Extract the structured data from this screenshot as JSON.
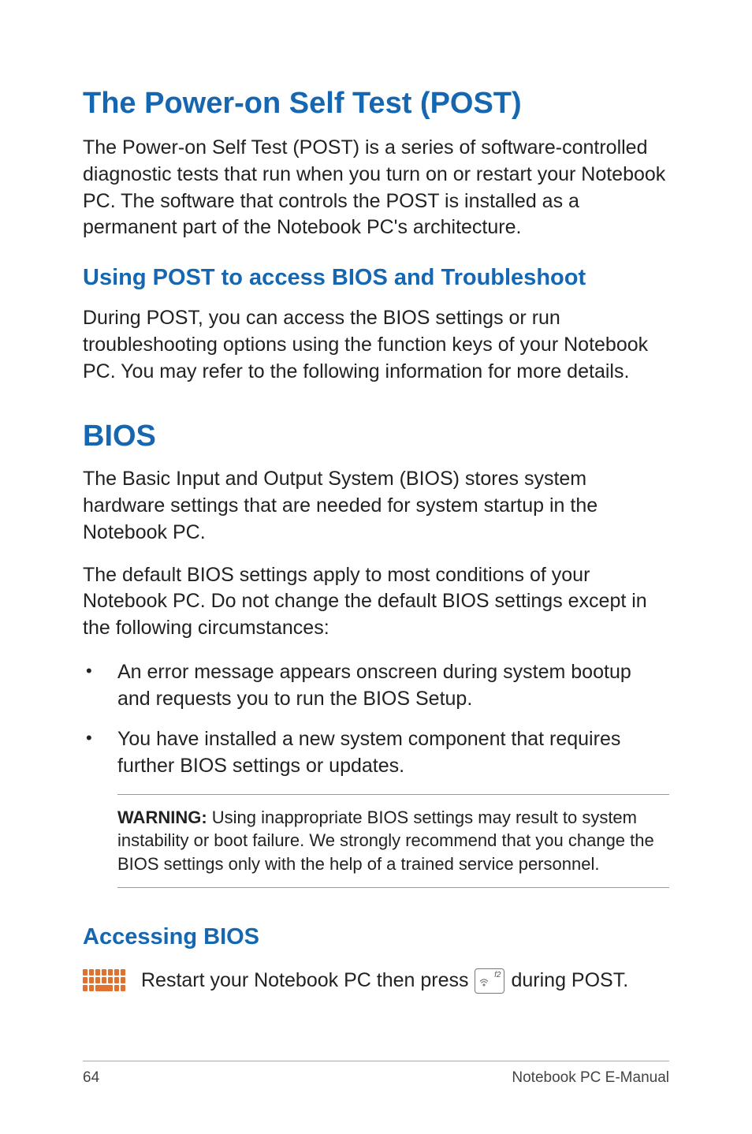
{
  "heading1": "The Power-on Self Test (POST)",
  "p1": "The Power-on Self Test (POST)  is a series of software-controlled diagnostic tests that run when you turn on or restart your Notebook PC. The software that controls the POST is installed as a permanent part of the Notebook PC's architecture.",
  "sub1": "Using POST to access BIOS and Troubleshoot",
  "p2": "During POST, you can access the BIOS settings or run troubleshooting options using the function keys of your Notebook PC. You may refer to the following information for more details.",
  "heading2": "BIOS",
  "p3": "The Basic Input and Output System (BIOS) stores system hardware settings that are needed for system startup in the Notebook PC.",
  "p4": "The default BIOS settings apply to most conditions of your Notebook PC. Do not change the default BIOS settings except in the following circumstances:",
  "bullets": {
    "0": "An error message appears onscreen during system bootup and requests you to run the BIOS Setup.",
    "1": "You have installed a new system component that requires further BIOS settings or updates."
  },
  "warning": {
    "label": "WARNING:",
    "text": " Using inappropriate BIOS settings may result to system instability or boot failure. We strongly recommend that you change the BIOS settings only with the help of a trained service personnel."
  },
  "sub2": "Accessing BIOS",
  "restart": {
    "before": "Restart your Notebook PC then press ",
    "keylabel": "f2",
    "after": " during POST."
  },
  "footer": {
    "page": "64",
    "title": "Notebook PC E-Manual"
  }
}
